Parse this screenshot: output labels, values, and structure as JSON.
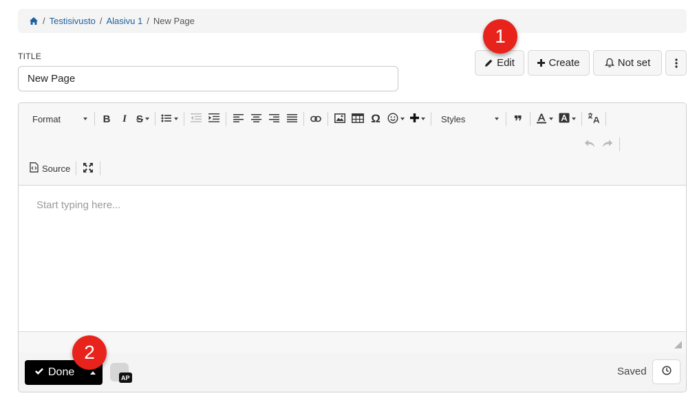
{
  "breadcrumb": {
    "home_icon": "home-icon",
    "items": [
      "Testisivusto",
      "Alasivu 1"
    ],
    "current": "New Page",
    "separator": "/"
  },
  "title": {
    "label": "TITLE",
    "value": "New Page"
  },
  "actions": {
    "edit_label": "Edit",
    "create_label": "Create",
    "notify_label": "Not set"
  },
  "toolbar": {
    "format_label": "Format",
    "styles_label": "Styles",
    "source_label": "Source",
    "bold_label": "B",
    "italic_label": "I",
    "strike_label": "S",
    "special_char_label": "Ω",
    "quote_label": "❞"
  },
  "editor": {
    "placeholder": "Start typing here..."
  },
  "footer": {
    "done_label": "Done",
    "avatar_tag": "AP",
    "status": "Saved"
  },
  "annotations": {
    "badge_1": "1",
    "badge_2": "2"
  },
  "colors": {
    "link": "#1b5f9e",
    "badge": "#e8231b",
    "done_bg": "#000000"
  }
}
